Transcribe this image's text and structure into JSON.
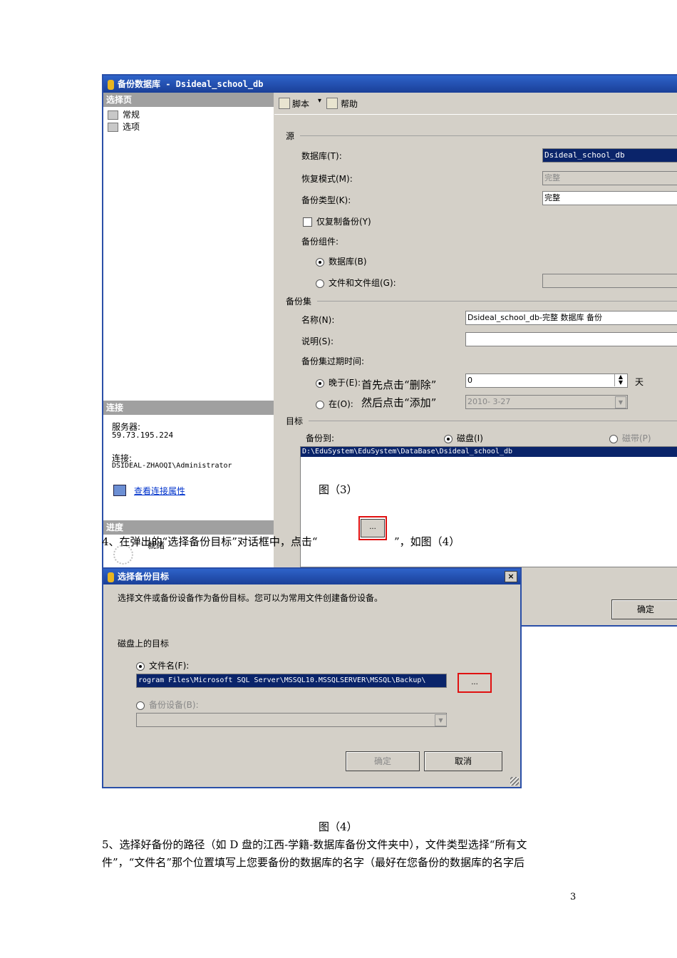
{
  "backup_dialog": {
    "title": "备份数据库 - Dsideal_school_db",
    "select_page_header": "选择页",
    "pages": [
      "常规",
      "选项"
    ],
    "connection_header": "连接",
    "server_label": "服务器:",
    "server_value": "59.73.195.224",
    "connection_label": "连接:",
    "connection_value": "DSIDEAL-ZHAOQI\\Administrator",
    "view_connection_link": "查看连接属性",
    "progress_header": "进度",
    "progress_status": "就绪",
    "toolbar": {
      "script": "脚本",
      "help": "帮助"
    },
    "source_group": "源",
    "database_label": "数据库(T):",
    "database_value": "Dsideal_school_db",
    "recovery_label": "恢复模式(M):",
    "recovery_value": "完整",
    "backup_type_label": "备份类型(K):",
    "backup_type_value": "完整",
    "copy_only_label": "仅复制备份(Y)",
    "component_label": "备份组件:",
    "component_database": "数据库(B)",
    "component_files": "文件和文件组(G):",
    "backup_set_group": "备份集",
    "name_label": "名称(N):",
    "name_value": "Dsideal_school_db-完整 数据库 备份",
    "desc_label": "说明(S):",
    "desc_value": "",
    "expire_label": "备份集过期时间:",
    "after_label": "晚于(E):",
    "after_value": "0",
    "days_label": "天",
    "on_label": "在(O):",
    "on_value": "2010- 3-27",
    "dest_group": "目标",
    "backup_to_label": "备份到:",
    "disk_label": "磁盘(I)",
    "tape_label": "磁带(P)",
    "dest_path": "D:\\EduSystem\\EduSystem\\DataBase\\Dsideal_school_db",
    "ok_button": "确定"
  },
  "overlay": {
    "note_line1": "首先点击“删除”",
    "note_line2": "然后点击“添加”",
    "figure3": "图（3）",
    "button_dots": "...",
    "step4": "4、在弹出的“选择备份目标”对话框中，点击“",
    "step4_end": "”，如图（4）"
  },
  "select_dialog": {
    "title": "选择备份目标",
    "close": "×",
    "description": "选择文件或备份设备作为备份目标。您可以为常用文件创建备份设备。",
    "disk_target_label": "磁盘上的目标",
    "file_name_label": "文件名(F):",
    "file_path": "rogram Files\\Microsoft SQL Server\\MSSQL10.MSSQLSERVER\\MSSQL\\Backup\\",
    "browse_button": "...",
    "backup_device_label": "备份设备(B):",
    "ok_button": "确定",
    "cancel_button": "取消"
  },
  "document": {
    "figure4": "图（4）",
    "step5_line1": "5、选择好备份的路径（如 D 盘的江西-学籍-数据库备份文件夹中），文件类型选择“所有文",
    "step5_line2": "件”，“文件名”那个位置填写上您要备份的数据库的名字（最好在您备份的数据库的名字后",
    "page_number": "3"
  },
  "colors": {
    "titlebar": "#1f4aa8",
    "highlight": "#0a246a",
    "red_frame": "#e01010"
  }
}
